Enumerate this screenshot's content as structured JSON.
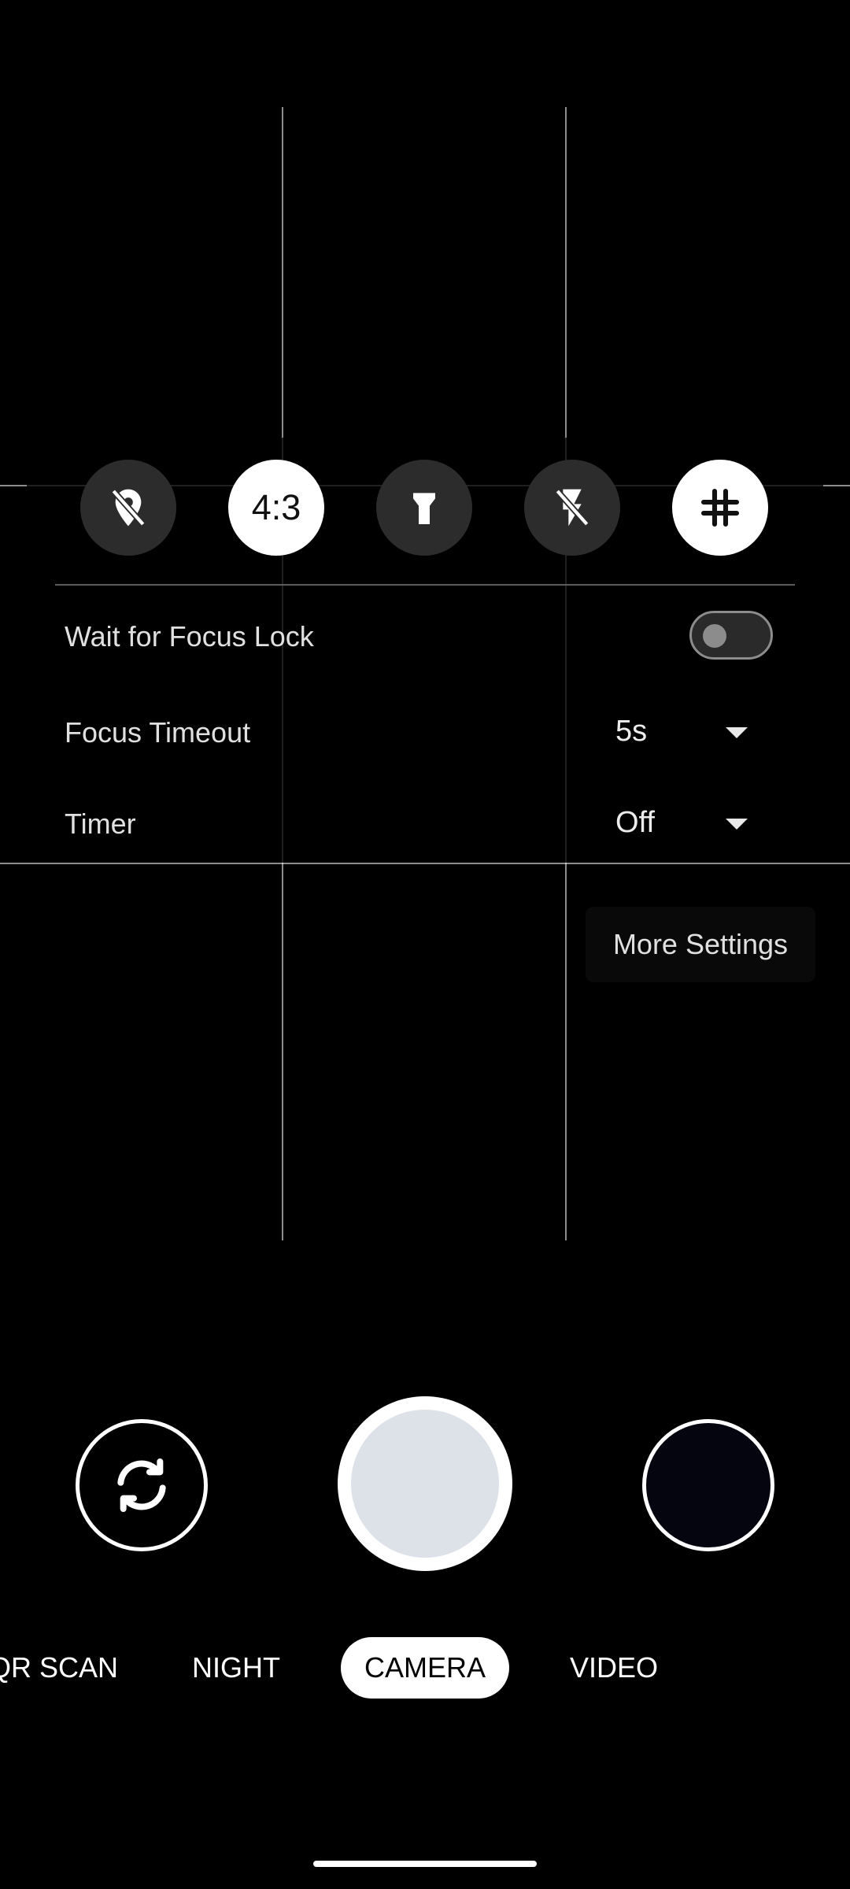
{
  "quick_settings": {
    "location_icon": "location-off-icon",
    "aspect_ratio": "4:3",
    "torch_icon": "flashlight-icon",
    "flash_icon": "flash-off-icon",
    "grid_icon": "grid-icon"
  },
  "settings": {
    "focus_lock_label": "Wait for Focus Lock",
    "focus_lock_on": false,
    "focus_timeout_label": "Focus Timeout",
    "focus_timeout_value": "5s",
    "timer_label": "Timer",
    "timer_value": "Off",
    "more_settings": "More Settings"
  },
  "controls": {
    "flip_icon": "flip-camera-icon",
    "shutter_icon": "shutter-button",
    "gallery_icon": "gallery-thumbnail"
  },
  "modes": [
    "QR SCAN",
    "NIGHT",
    "CAMERA",
    "VIDEO"
  ],
  "active_mode": "CAMERA",
  "colors": {
    "background": "#000000",
    "button_inactive": "#2c2c2c",
    "button_active": "#ffffff",
    "shutter_inner": "#dde1e8"
  }
}
